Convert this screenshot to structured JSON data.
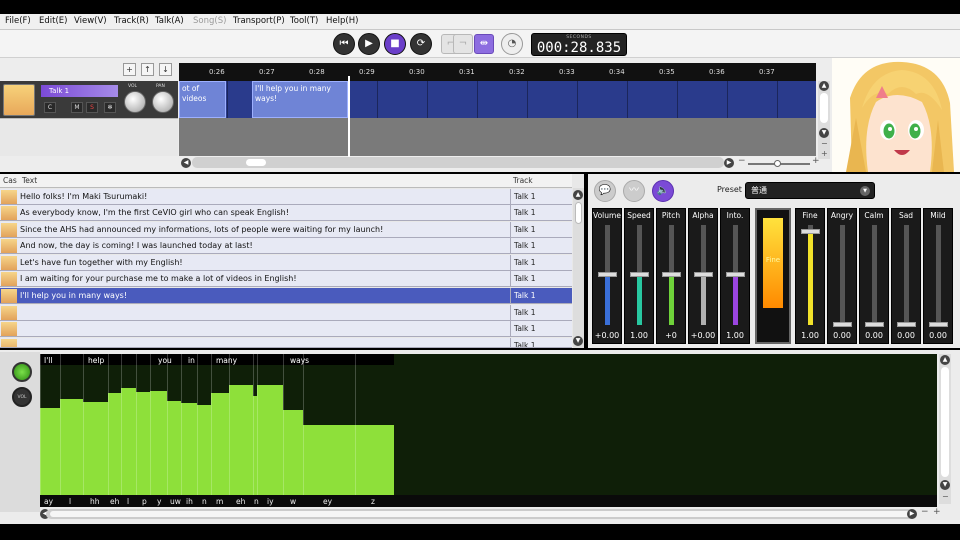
{
  "menu": [
    {
      "label": "File(F)",
      "disabled": false
    },
    {
      "label": "Edit(E)",
      "disabled": false
    },
    {
      "label": "View(V)",
      "disabled": false
    },
    {
      "label": "Track(R)",
      "disabled": false
    },
    {
      "label": "Talk(A)",
      "disabled": false
    },
    {
      "label": "Song(S)",
      "disabled": true
    },
    {
      "label": "Transport(P)",
      "disabled": false
    },
    {
      "label": "Tool(T)",
      "disabled": false
    },
    {
      "label": "Help(H)",
      "disabled": false
    }
  ],
  "transport": {
    "time_label": "SECONDS",
    "time_value": "000:28.835"
  },
  "track": {
    "name": "Talk 1",
    "btn_c": "C",
    "btn_m": "M",
    "btn_s": "S",
    "vol_label": "VOL",
    "pan_label": "PAN",
    "ruler_ticks": [
      "0:26",
      "0:27",
      "0:28",
      "0:29",
      "0:30",
      "0:31",
      "0:32",
      "0:33",
      "0:34",
      "0:35",
      "0:36",
      "0:37"
    ],
    "clips": [
      "ot of videos",
      "I'll help you in many ways!"
    ]
  },
  "list": {
    "col_cast": "Cas",
    "col_text": "Text",
    "col_track": "Track",
    "rows": [
      {
        "text": "Hello folks! I'm Maki Tsurumaki!",
        "track": "Talk 1",
        "selected": false
      },
      {
        "text": "As everybody know, I'm the first CeVIO girl who can speak English!",
        "track": "Talk 1",
        "selected": false
      },
      {
        "text": "Since the AHS had announced my informations, lots of people were waiting for my launch!",
        "track": "Talk 1",
        "selected": false
      },
      {
        "text": "And now, the day is coming! I was launched today at last!",
        "track": "Talk 1",
        "selected": false
      },
      {
        "text": "Let's have fun together with my English!",
        "track": "Talk 1",
        "selected": false
      },
      {
        "text": "I am waiting for your purchase me to make a lot of videos in English!",
        "track": "Talk 1",
        "selected": false
      },
      {
        "text": "I'll help you in many ways!",
        "track": "Talk 1",
        "selected": true
      },
      {
        "text": "",
        "track": "Talk 1",
        "selected": false
      },
      {
        "text": "",
        "track": "Talk 1",
        "selected": false
      },
      {
        "text": "",
        "track": "Talk 1",
        "selected": false
      }
    ]
  },
  "params": {
    "preset_label": "Preset",
    "preset_value": "普通",
    "sliders": [
      {
        "name": "Volume",
        "value": "+0.00",
        "level": 0.5,
        "color": "#3a6fd8"
      },
      {
        "name": "Speed",
        "value": "1.00",
        "level": 0.5,
        "color": "#28c7a0"
      },
      {
        "name": "Pitch",
        "value": "+0",
        "level": 0.5,
        "color": "#6fd23a"
      },
      {
        "name": "Alpha",
        "value": "+0.00",
        "level": 0.5,
        "color": "#b0b0b0"
      },
      {
        "name": "Into.",
        "value": "1.00",
        "level": 0.5,
        "color": "#9b45e0"
      }
    ],
    "emotion_main_label": "Fine",
    "emotion_level": 1.0,
    "emotions": [
      {
        "name": "Fine",
        "value": "1.00",
        "level": 0.93,
        "color": "#f2e22a"
      },
      {
        "name": "Angry",
        "value": "0.00",
        "level": 0.0,
        "color": "#888888"
      },
      {
        "name": "Calm",
        "value": "0.00",
        "level": 0.0,
        "color": "#888888"
      },
      {
        "name": "Sad",
        "value": "0.00",
        "level": 0.0,
        "color": "#888888"
      },
      {
        "name": "Mild",
        "value": "0.00",
        "level": 0.0,
        "color": "#888888"
      }
    ]
  },
  "pitch": {
    "vol_label": "VOL",
    "words": [
      "I'll",
      "help",
      "you",
      "in",
      "many",
      "ways"
    ],
    "phonemes": [
      "ay",
      "l",
      "hh",
      "eh",
      "l",
      "p",
      "y",
      "uw",
      "ih",
      "n",
      "m",
      "eh",
      "n",
      "iy",
      "w",
      "ey",
      "z"
    ]
  }
}
